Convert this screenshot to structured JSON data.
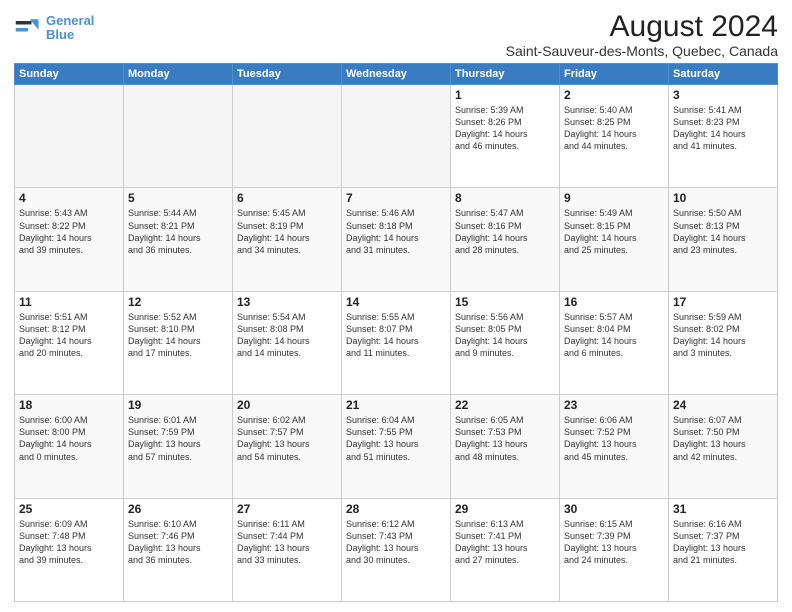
{
  "header": {
    "logo_line1": "General",
    "logo_line2": "Blue",
    "main_title": "August 2024",
    "subtitle": "Saint-Sauveur-des-Monts, Quebec, Canada"
  },
  "weekdays": [
    "Sunday",
    "Monday",
    "Tuesday",
    "Wednesday",
    "Thursday",
    "Friday",
    "Saturday"
  ],
  "weeks": [
    [
      {
        "day": "",
        "info": ""
      },
      {
        "day": "",
        "info": ""
      },
      {
        "day": "",
        "info": ""
      },
      {
        "day": "",
        "info": ""
      },
      {
        "day": "1",
        "info": "Sunrise: 5:39 AM\nSunset: 8:26 PM\nDaylight: 14 hours\nand 46 minutes."
      },
      {
        "day": "2",
        "info": "Sunrise: 5:40 AM\nSunset: 8:25 PM\nDaylight: 14 hours\nand 44 minutes."
      },
      {
        "day": "3",
        "info": "Sunrise: 5:41 AM\nSunset: 8:23 PM\nDaylight: 14 hours\nand 41 minutes."
      }
    ],
    [
      {
        "day": "4",
        "info": "Sunrise: 5:43 AM\nSunset: 8:22 PM\nDaylight: 14 hours\nand 39 minutes."
      },
      {
        "day": "5",
        "info": "Sunrise: 5:44 AM\nSunset: 8:21 PM\nDaylight: 14 hours\nand 36 minutes."
      },
      {
        "day": "6",
        "info": "Sunrise: 5:45 AM\nSunset: 8:19 PM\nDaylight: 14 hours\nand 34 minutes."
      },
      {
        "day": "7",
        "info": "Sunrise: 5:46 AM\nSunset: 8:18 PM\nDaylight: 14 hours\nand 31 minutes."
      },
      {
        "day": "8",
        "info": "Sunrise: 5:47 AM\nSunset: 8:16 PM\nDaylight: 14 hours\nand 28 minutes."
      },
      {
        "day": "9",
        "info": "Sunrise: 5:49 AM\nSunset: 8:15 PM\nDaylight: 14 hours\nand 25 minutes."
      },
      {
        "day": "10",
        "info": "Sunrise: 5:50 AM\nSunset: 8:13 PM\nDaylight: 14 hours\nand 23 minutes."
      }
    ],
    [
      {
        "day": "11",
        "info": "Sunrise: 5:51 AM\nSunset: 8:12 PM\nDaylight: 14 hours\nand 20 minutes."
      },
      {
        "day": "12",
        "info": "Sunrise: 5:52 AM\nSunset: 8:10 PM\nDaylight: 14 hours\nand 17 minutes."
      },
      {
        "day": "13",
        "info": "Sunrise: 5:54 AM\nSunset: 8:08 PM\nDaylight: 14 hours\nand 14 minutes."
      },
      {
        "day": "14",
        "info": "Sunrise: 5:55 AM\nSunset: 8:07 PM\nDaylight: 14 hours\nand 11 minutes."
      },
      {
        "day": "15",
        "info": "Sunrise: 5:56 AM\nSunset: 8:05 PM\nDaylight: 14 hours\nand 9 minutes."
      },
      {
        "day": "16",
        "info": "Sunrise: 5:57 AM\nSunset: 8:04 PM\nDaylight: 14 hours\nand 6 minutes."
      },
      {
        "day": "17",
        "info": "Sunrise: 5:59 AM\nSunset: 8:02 PM\nDaylight: 14 hours\nand 3 minutes."
      }
    ],
    [
      {
        "day": "18",
        "info": "Sunrise: 6:00 AM\nSunset: 8:00 PM\nDaylight: 14 hours\nand 0 minutes."
      },
      {
        "day": "19",
        "info": "Sunrise: 6:01 AM\nSunset: 7:59 PM\nDaylight: 13 hours\nand 57 minutes."
      },
      {
        "day": "20",
        "info": "Sunrise: 6:02 AM\nSunset: 7:57 PM\nDaylight: 13 hours\nand 54 minutes."
      },
      {
        "day": "21",
        "info": "Sunrise: 6:04 AM\nSunset: 7:55 PM\nDaylight: 13 hours\nand 51 minutes."
      },
      {
        "day": "22",
        "info": "Sunrise: 6:05 AM\nSunset: 7:53 PM\nDaylight: 13 hours\nand 48 minutes."
      },
      {
        "day": "23",
        "info": "Sunrise: 6:06 AM\nSunset: 7:52 PM\nDaylight: 13 hours\nand 45 minutes."
      },
      {
        "day": "24",
        "info": "Sunrise: 6:07 AM\nSunset: 7:50 PM\nDaylight: 13 hours\nand 42 minutes."
      }
    ],
    [
      {
        "day": "25",
        "info": "Sunrise: 6:09 AM\nSunset: 7:48 PM\nDaylight: 13 hours\nand 39 minutes."
      },
      {
        "day": "26",
        "info": "Sunrise: 6:10 AM\nSunset: 7:46 PM\nDaylight: 13 hours\nand 36 minutes."
      },
      {
        "day": "27",
        "info": "Sunrise: 6:11 AM\nSunset: 7:44 PM\nDaylight: 13 hours\nand 33 minutes."
      },
      {
        "day": "28",
        "info": "Sunrise: 6:12 AM\nSunset: 7:43 PM\nDaylight: 13 hours\nand 30 minutes."
      },
      {
        "day": "29",
        "info": "Sunrise: 6:13 AM\nSunset: 7:41 PM\nDaylight: 13 hours\nand 27 minutes."
      },
      {
        "day": "30",
        "info": "Sunrise: 6:15 AM\nSunset: 7:39 PM\nDaylight: 13 hours\nand 24 minutes."
      },
      {
        "day": "31",
        "info": "Sunrise: 6:16 AM\nSunset: 7:37 PM\nDaylight: 13 hours\nand 21 minutes."
      }
    ]
  ]
}
